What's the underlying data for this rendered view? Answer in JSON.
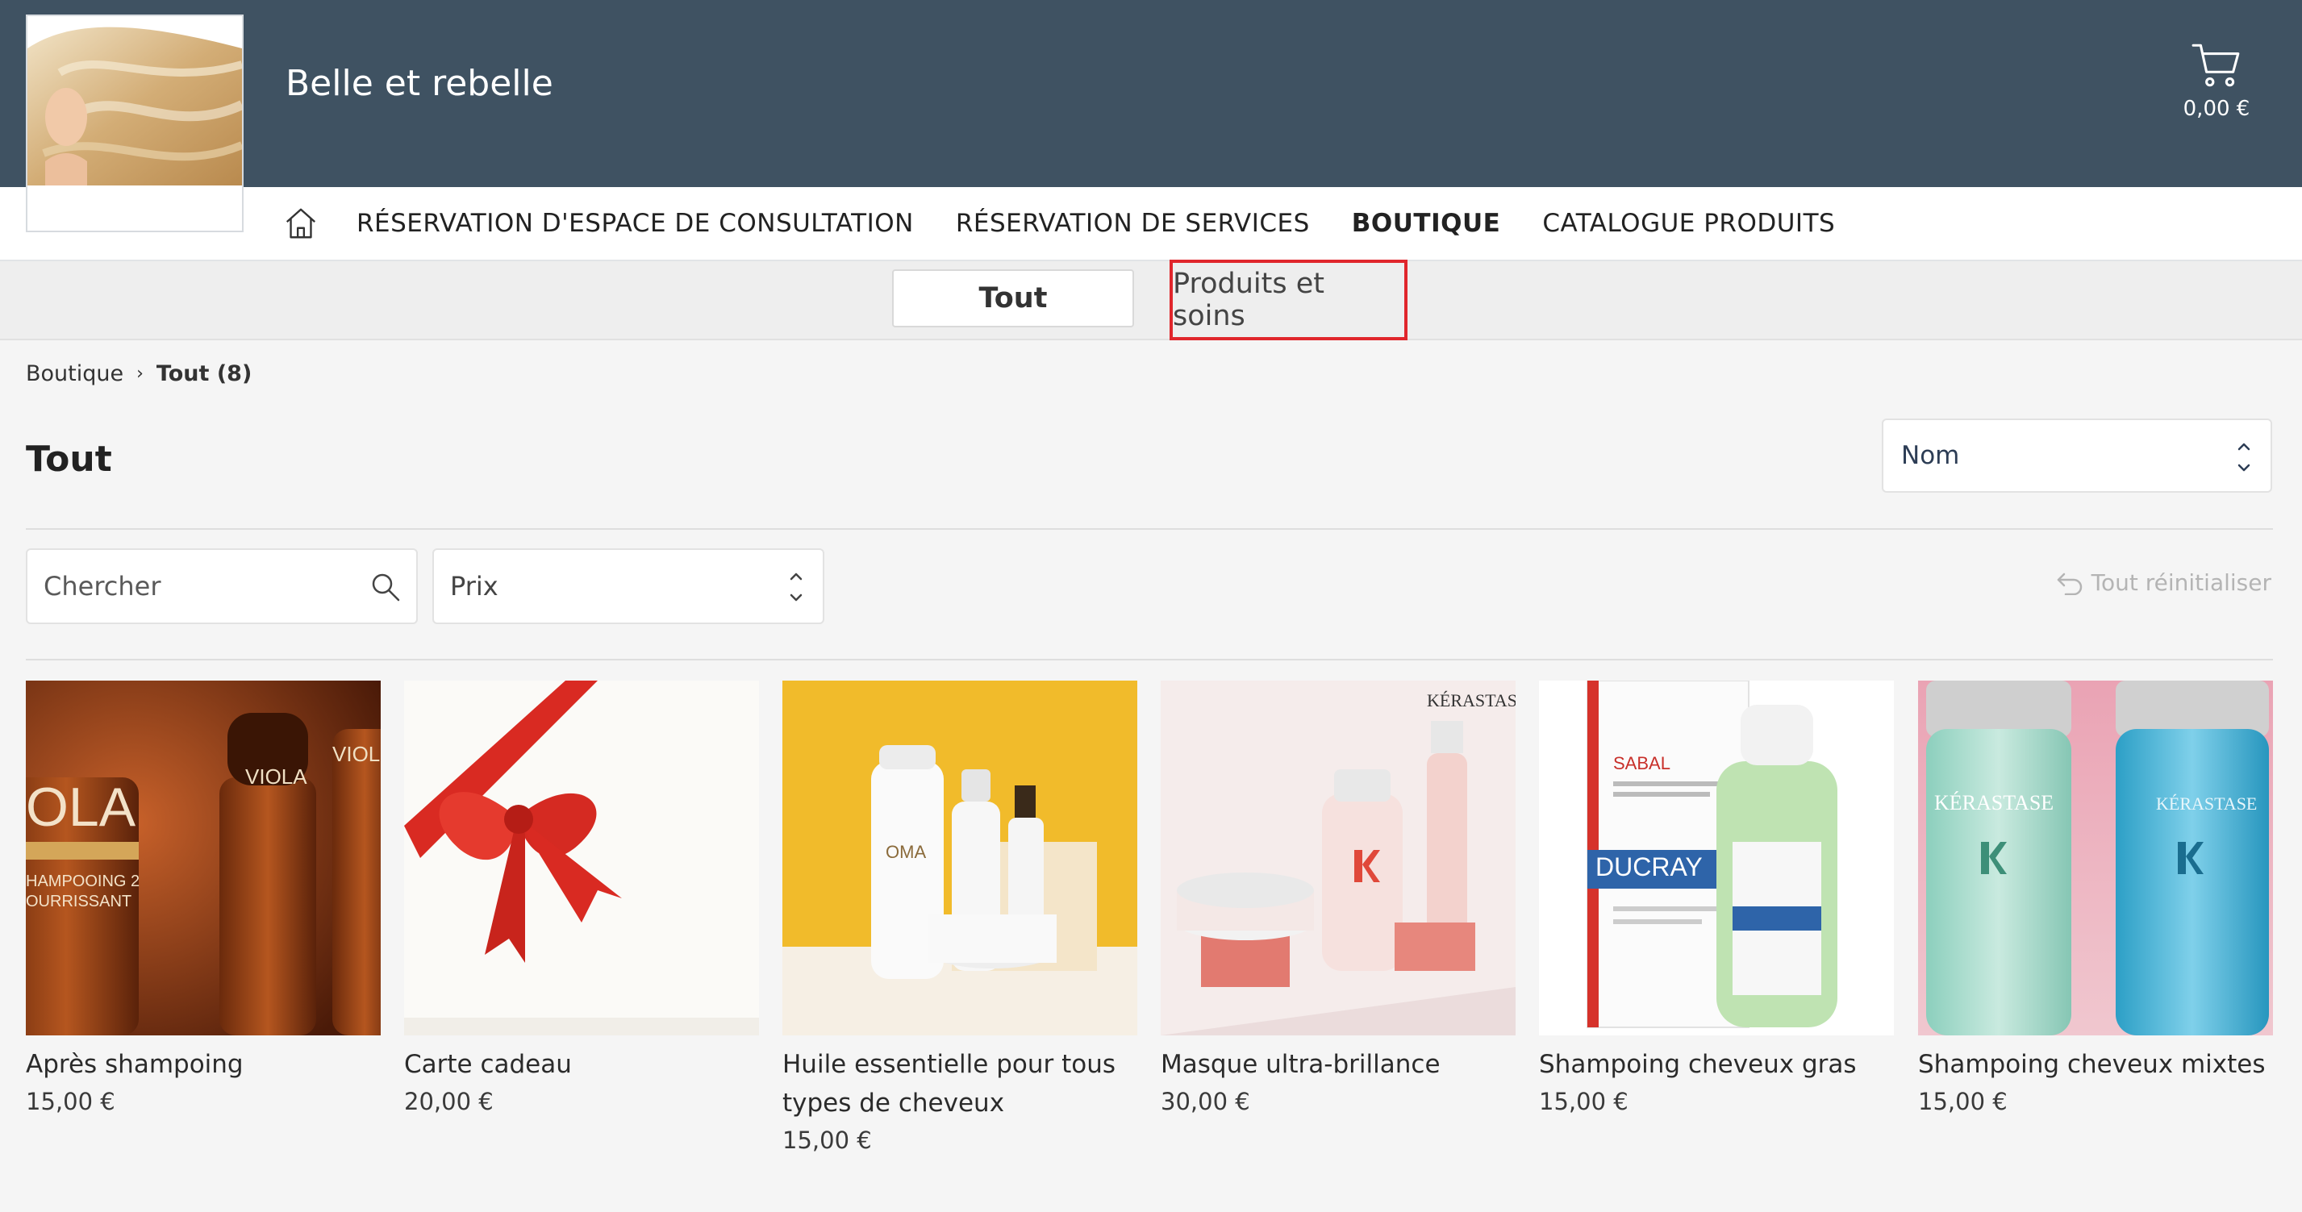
{
  "header": {
    "shop_name": "Belle et rebelle",
    "cart_amount": "0,00 €"
  },
  "nav": {
    "items": [
      {
        "label": "RÉSERVATION D'ESPACE DE CONSULTATION",
        "active": false
      },
      {
        "label": "RÉSERVATION DE SERVICES",
        "active": false
      },
      {
        "label": "BOUTIQUE",
        "active": true
      },
      {
        "label": "CATALOGUE PRODUITS",
        "active": false
      }
    ]
  },
  "categories": [
    {
      "label": "Tout",
      "selected": true
    },
    {
      "label": "Produits et soins",
      "selected": false
    }
  ],
  "breadcrumb": {
    "root": "Boutique",
    "separator": "›",
    "current": "Tout (8)"
  },
  "page": {
    "title": "Tout",
    "sort_value": "Nom"
  },
  "filters": {
    "search_placeholder": "Chercher",
    "price_label": "Prix",
    "reset_label": "Tout réinitialiser"
  },
  "products": [
    {
      "name": "Après shampoing",
      "price": "15,00 €",
      "image": "brown-shampoo-bottles"
    },
    {
      "name": "Carte cadeau",
      "price": "20,00 €",
      "image": "red-ribbon-gift"
    },
    {
      "name": "Huile essentielle pour tous types de cheveux",
      "price": "15,00 €",
      "image": "white-bottles-yellow-bg"
    },
    {
      "name": "Masque ultra-brillance",
      "price": "30,00 €",
      "image": "kerastase-pink-set",
      "brand_text": "KÉRASTASE"
    },
    {
      "name": "Shampoing cheveux gras",
      "price": "15,00 €",
      "image": "ducray-sabal-box",
      "brand_text": "DUCRAY"
    },
    {
      "name": "Shampoing cheveux mixtes",
      "price": "15,00 €",
      "image": "kerastase-blue-bottles",
      "brand_text": "KÉRASTASE"
    }
  ],
  "colors": {
    "header_bg": "#3f5262",
    "highlight": "#e0262c",
    "page_bg": "#f5f5f5"
  }
}
